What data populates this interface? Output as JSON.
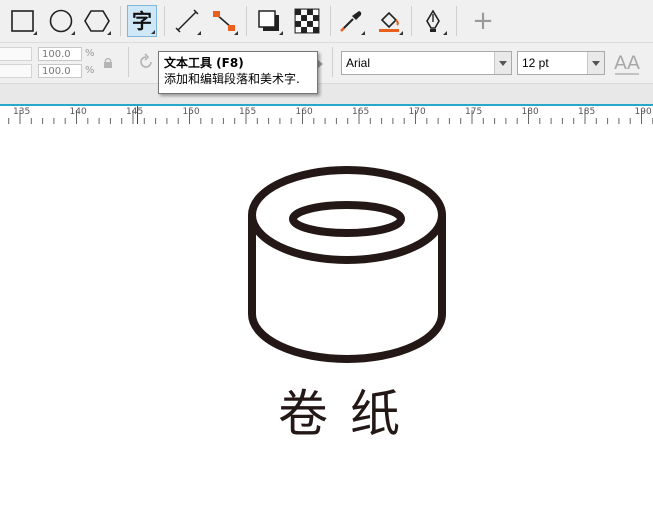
{
  "toolbar": {
    "tools": [
      {
        "name": "rectangle-tool",
        "icon": "rectangle-icon"
      },
      {
        "name": "ellipse-tool",
        "icon": "ellipse-icon"
      },
      {
        "name": "polygon-tool",
        "icon": "hexagon-icon"
      },
      {
        "name": "text-tool",
        "icon": "text-char-icon",
        "glyph": "字",
        "active": true
      },
      {
        "name": "dimension-tool",
        "icon": "dimension-line-icon"
      },
      {
        "name": "connector-tool",
        "icon": "connector-icon"
      },
      {
        "name": "drop-shadow-tool",
        "icon": "drop-shadow-icon"
      },
      {
        "name": "transparency-tool",
        "icon": "checkerboard-icon"
      },
      {
        "name": "eyedropper-tool",
        "icon": "eyedropper-icon"
      },
      {
        "name": "interactive-fill-tool",
        "icon": "paint-bucket-icon"
      },
      {
        "name": "pen-tool",
        "icon": "pen-nib-icon"
      },
      {
        "name": "add-tool",
        "icon": "plus-icon",
        "glyph": "+"
      }
    ]
  },
  "propertybar": {
    "scale_x": "100.0",
    "scale_y": "100.0",
    "percent": "%",
    "font_name": "Arial",
    "font_size": "12 pt"
  },
  "tooltip": {
    "title": "文本工具 (F8)",
    "description": "添加和编辑段落和美术字."
  },
  "ruler": {
    "labels": [
      "135",
      "140",
      "145",
      "150",
      "155",
      "160",
      "165",
      "170",
      "175",
      "180",
      "185",
      "190"
    ]
  },
  "canvas": {
    "caption": "卷纸"
  },
  "colors": {
    "accent": "#28a8c8",
    "icon_orange": "#e8601c",
    "drawing": "#231815"
  }
}
